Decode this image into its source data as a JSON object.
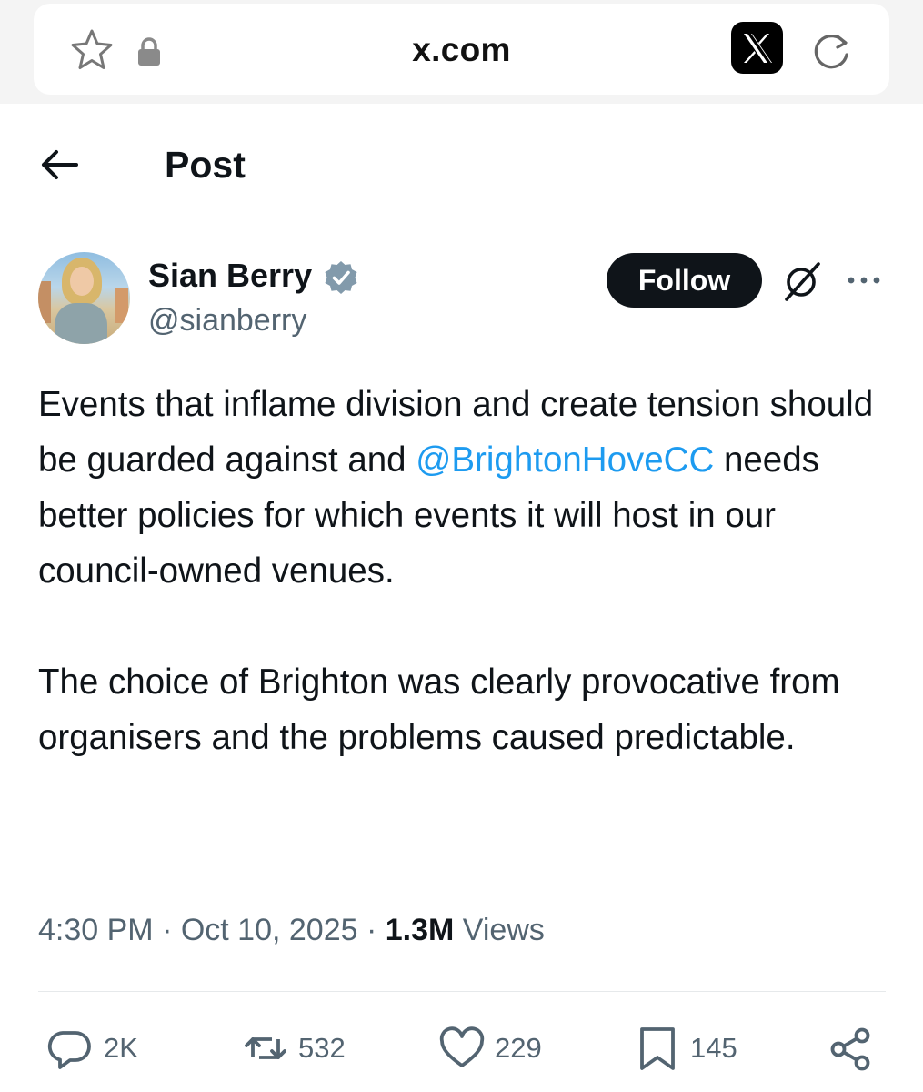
{
  "browser": {
    "url": "x.com",
    "icons": [
      "star-icon",
      "lock-icon",
      "x-logo-icon",
      "reload-icon"
    ]
  },
  "header": {
    "back_icon": "arrow-left-icon",
    "title": "Post"
  },
  "author": {
    "display_name": "Sian Berry",
    "handle": "@sianberry",
    "verified": true,
    "verified_color": "#829aab"
  },
  "actions_top": {
    "follow_label": "Follow",
    "grok_icon": "grok-icon",
    "more_icon": "more-dots-icon"
  },
  "tweet": {
    "p1_before": "Events that inflame division and create tension should be guarded against and ",
    "mention": "@BrightonHoveCC",
    "p1_after": " needs better policies for which events it will host in our council-owned venues.",
    "p2": "The choice of Brighton was clearly provocative from organisers and the problems caused predictable."
  },
  "meta": {
    "time": "4:30 PM",
    "separator": " · ",
    "date": "Oct 10, 2025",
    "views_count": "1.3M",
    "views_label": " Views"
  },
  "engagement": {
    "replies": "2K",
    "reposts": "532",
    "likes": "229",
    "bookmarks": "145"
  },
  "colors": {
    "text": "#0f1419",
    "secondary": "#536471",
    "link": "#1d9bf0",
    "chrome_bg": "#f4f4f4"
  }
}
